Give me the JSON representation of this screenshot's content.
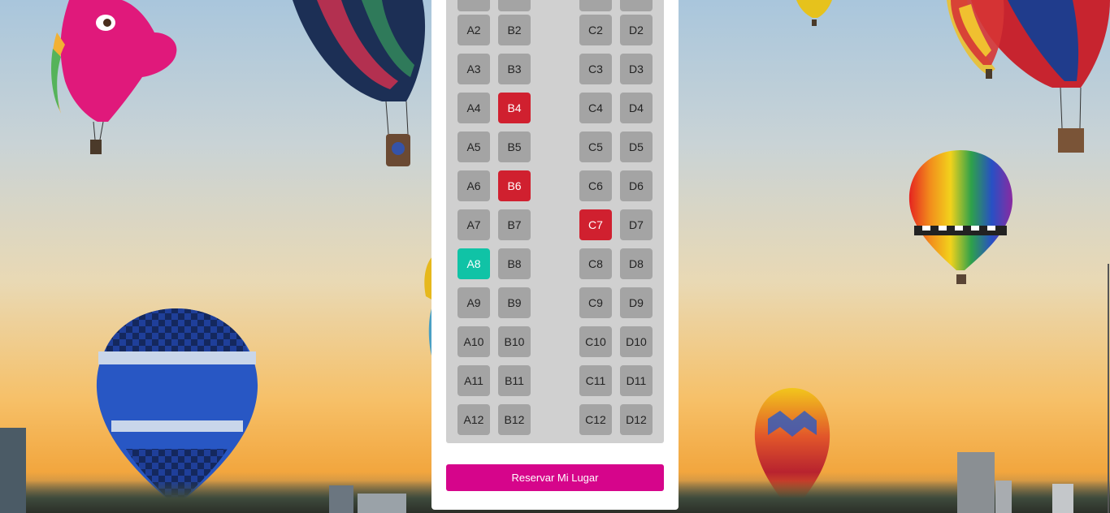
{
  "colors": {
    "seat_available": "#a4a4a4",
    "seat_occupied": "#d0202f",
    "seat_selected": "#10c3a6",
    "reserve_button": "#d6058b"
  },
  "seat_map": {
    "rows": [
      [
        {
          "label": "A2",
          "status": "available"
        },
        {
          "label": "B2",
          "status": "available"
        },
        {
          "label": "C2",
          "status": "available"
        },
        {
          "label": "D2",
          "status": "available"
        }
      ],
      [
        {
          "label": "A3",
          "status": "available"
        },
        {
          "label": "B3",
          "status": "available"
        },
        {
          "label": "C3",
          "status": "available"
        },
        {
          "label": "D3",
          "status": "available"
        }
      ],
      [
        {
          "label": "A4",
          "status": "available"
        },
        {
          "label": "B4",
          "status": "occupied"
        },
        {
          "label": "C4",
          "status": "available"
        },
        {
          "label": "D4",
          "status": "available"
        }
      ],
      [
        {
          "label": "A5",
          "status": "available"
        },
        {
          "label": "B5",
          "status": "available"
        },
        {
          "label": "C5",
          "status": "available"
        },
        {
          "label": "D5",
          "status": "available"
        }
      ],
      [
        {
          "label": "A6",
          "status": "available"
        },
        {
          "label": "B6",
          "status": "occupied"
        },
        {
          "label": "C6",
          "status": "available"
        },
        {
          "label": "D6",
          "status": "available"
        }
      ],
      [
        {
          "label": "A7",
          "status": "available"
        },
        {
          "label": "B7",
          "status": "available"
        },
        {
          "label": "C7",
          "status": "occupied"
        },
        {
          "label": "D7",
          "status": "available"
        }
      ],
      [
        {
          "label": "A8",
          "status": "selected"
        },
        {
          "label": "B8",
          "status": "available"
        },
        {
          "label": "C8",
          "status": "available"
        },
        {
          "label": "D8",
          "status": "available"
        }
      ],
      [
        {
          "label": "A9",
          "status": "available"
        },
        {
          "label": "B9",
          "status": "available"
        },
        {
          "label": "C9",
          "status": "available"
        },
        {
          "label": "D9",
          "status": "available"
        }
      ],
      [
        {
          "label": "A10",
          "status": "available"
        },
        {
          "label": "B10",
          "status": "available"
        },
        {
          "label": "C10",
          "status": "available"
        },
        {
          "label": "D10",
          "status": "available"
        }
      ],
      [
        {
          "label": "A11",
          "status": "available"
        },
        {
          "label": "B11",
          "status": "available"
        },
        {
          "label": "C11",
          "status": "available"
        },
        {
          "label": "D11",
          "status": "available"
        }
      ],
      [
        {
          "label": "A12",
          "status": "available"
        },
        {
          "label": "B12",
          "status": "available"
        },
        {
          "label": "C12",
          "status": "available"
        },
        {
          "label": "D12",
          "status": "available"
        }
      ]
    ]
  },
  "reserve_button": {
    "label": "Reservar Mi Lugar"
  }
}
